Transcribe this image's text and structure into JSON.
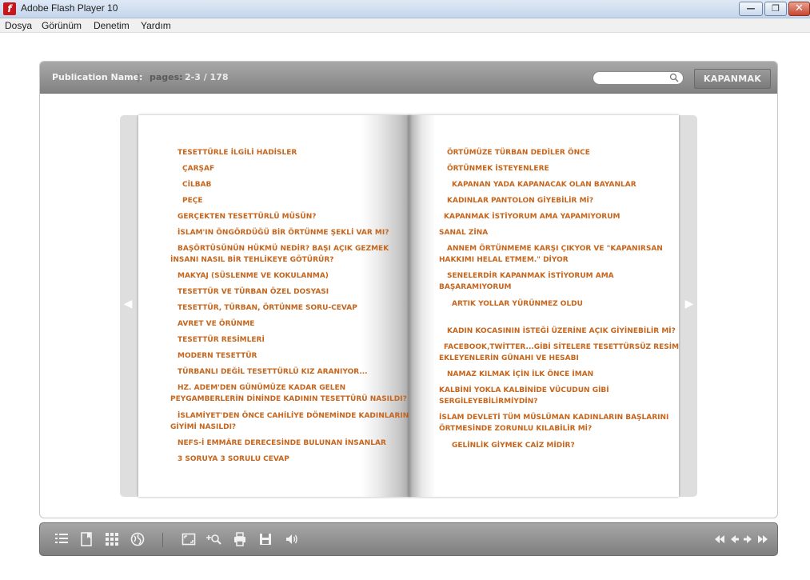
{
  "window": {
    "title": "Adobe Flash Player 10",
    "app_icon_glyph": "f"
  },
  "window_controls": {
    "minimize_glyph": "—",
    "maximize_glyph": "❐",
    "close_glyph": "✕"
  },
  "menu": [
    "Dosya",
    "Görünüm",
    "Denetim",
    "Yardım"
  ],
  "viewer": {
    "publication_label": "Publication Name:",
    "separator": "|",
    "pages_label": "pages:",
    "pages_value": "2-3  /  178",
    "search_placeholder": "",
    "close_button": "KAPANMAK",
    "prev_glyph": "◀",
    "next_glyph": "▶"
  },
  "left_page": {
    "items": [
      "TESETTÜRLE İLGİLİ HADİSLER",
      "ÇARŞAF",
      "CİLBAB",
      "PEÇE",
      "GERÇEKTEN TESETTÜRLÜ MÜSÜN?",
      "İSLAM'IN ÖNGÖRDÜĞÜ BİR ÖRTÜNME ŞEKLİ VAR MI?",
      "BAŞÖRTÜSÜNÜN HÜKMÜ NEDİR? BAŞI AÇIK GEZMEK",
      "İNSANI NASIL BİR TEHLİKEYE GÖTÜRÜR?",
      "MAKYAJ (SÜSLENME VE KOKULANMA)",
      "TESETTÜR VE TÜRBAN ÖZEL DOSYASI",
      "TESETTÜR, TÜRBAN, ÖRTÜNME SORU-CEVAP",
      "AVRET VE ÖRÜNME",
      "TESETTÜR RESİMLERİ",
      "MODERN TESETTÜR",
      "TÜRBANLI DEĞİL TESETTÜRLÜ KIZ ARANIYOR...",
      "HZ. ADEM'DEN GÜNÜMÜZE KADAR GELEN",
      "PEYGAMBERLERİN DİNİNDE KADININ TESETTÜRÜ NASILDI?",
      "İSLAMİYET'DEN ÖNCE CAHİLİYE DÖNEMİNDE KADINLARIN",
      "GİYİMİ NASILDI?",
      "NEFS-İ EMMÂRE DERECESİNDE BULUNAN İNSANLAR",
      "3 SORUYA 3 SORULU CEVAP"
    ]
  },
  "right_page": {
    "items": [
      "ÖRTÜMÜZE TÜRBAN DEDİLER ÖNCE",
      "ÖRTÜNMEK İSTEYENLERE",
      "KAPANAN YADA KAPANACAK OLAN BAYANLAR",
      "KADINLAR PANTOLON GİYEBİLİR Mİ?",
      "KAPANMAK İSTİYORUM AMA YAPAMIYORUM",
      "SANAL ZİNA",
      "ANNEM ÖRTÜNMEME KARŞI ÇIKYOR VE \"KAPANIRSAN",
      "HAKKIMI HELAL ETMEM.\" DİYOR",
      "SENELERDİR KAPANMAK İSTİYORUM AMA",
      "BAŞARAMIYORUM",
      "ARTIK YOLLAR YÜRÜNMEZ OLDU",
      "KADIN KOCASININ İSTEĞİ ÜZERİNE AÇIK GİYİNEBİLİR Mİ?",
      "FACEBOOK,TWİTTER...GİBİ SİTELERE TESETTÜRSÜZ RESİM",
      "EKLEYENLERİN GÜNAHI VE HESABI",
      "NAMAZ KILMAK İÇİN İLK ÖNCE İMAN",
      "KALBİNİ YOKLA KALBİNİDE VÜCUDUN GİBİ",
      "SERGİLEYEBİLİRMİYDİN?",
      "İSLAM DEVLETİ TÜM MÜSLÜMAN KADINLARIN BAŞLARINI",
      "ÖRTMESİNDE ZORUNLU KILABİLİR Mİ?",
      "GELİNLİK GİYMEK CAİZ MİDİR?"
    ]
  },
  "toolbar_icons": [
    "table-of-contents-icon",
    "bookmark-icon",
    "thumbnails-icon",
    "share-icon",
    "fullscreen-icon",
    "zoom-in-icon",
    "print-icon",
    "save-icon",
    "sound-icon",
    "first-page-icon",
    "previous-page-icon",
    "next-page-icon",
    "last-page-icon"
  ]
}
